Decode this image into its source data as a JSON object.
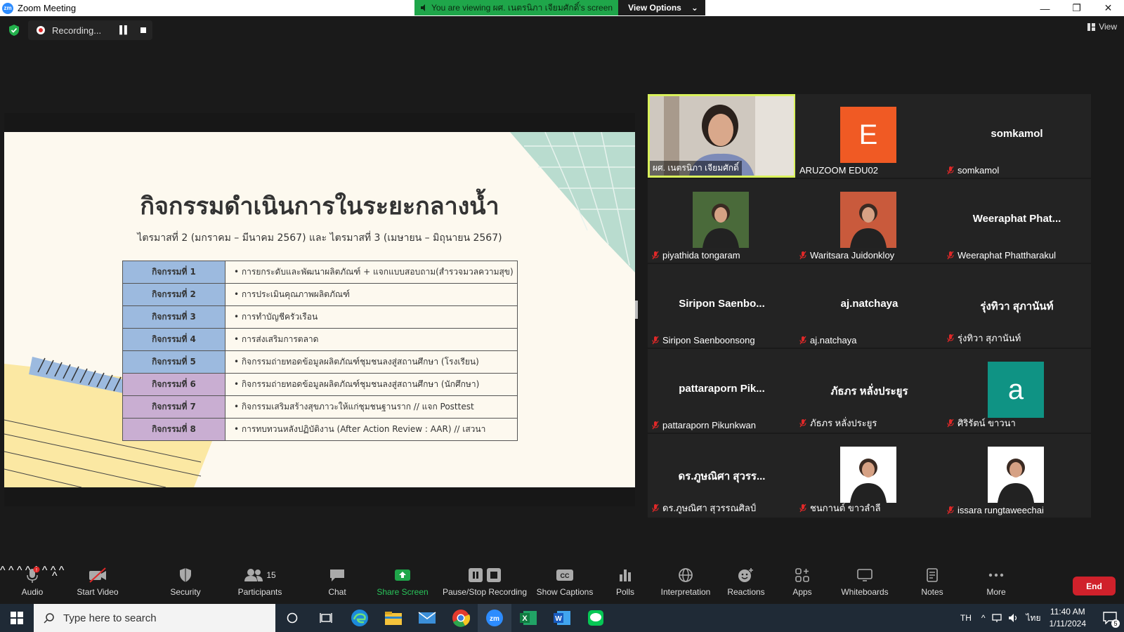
{
  "window": {
    "title": "Zoom Meeting",
    "sharing_banner": "You are viewing ผศ. เนตรนิภา เจียมศักดิ์'s screen",
    "view_options": "View Options"
  },
  "topbar": {
    "recording": "Recording...",
    "view": "View"
  },
  "slide": {
    "title": "กิจกรรมดำเนินการในระยะกลางน้ำ",
    "subtitle": "ไตรมาสที่ 2 (มกราคม – มีนาคม 2567) และ ไตรมาสที่ 3 (เมษายน – มิถุนายน 2567)",
    "activities": [
      {
        "key": "กิจกรรมที่ 1",
        "desc": "การยกระดับและพัฒนาผลิตภัณฑ์ + แจกแบบสอบถาม(สำรวจมวลความสุข)",
        "color": "#9cbadf"
      },
      {
        "key": "กิจกรรมที่ 2",
        "desc": "การประเมินคุณภาพผลิตภัณฑ์",
        "color": "#9cbadf"
      },
      {
        "key": "กิจกรรมที่ 3",
        "desc": "การทำบัญชีครัวเรือน",
        "color": "#9cbadf"
      },
      {
        "key": "กิจกรรมที่ 4",
        "desc": "การส่งเสริมการตลาด",
        "color": "#9cbadf"
      },
      {
        "key": "กิจกรรมที่ 5",
        "desc": "กิจกรรมถ่ายทอดข้อมูลผลิตภัณฑ์ชุมชนลงสู่สถานศึกษา (โรงเรียน)",
        "color": "#9cbadf"
      },
      {
        "key": "กิจกรรมที่ 6",
        "desc": "กิจกรรมถ่ายทอดข้อมูลผลิตภัณฑ์ชุมชนลงสู่สถานศึกษา (นักศึกษา)",
        "color": "#c9aed2"
      },
      {
        "key": "กิจกรรมที่ 7",
        "desc": "กิจกรรมเสริมสร้างสุขภาวะให้แก่ชุมชนฐานราก // แจก Posttest",
        "color": "#c9aed2"
      },
      {
        "key": "กิจกรรมที่ 8",
        "desc": "การทบทวนหลังปฏิบัติงาน (After Action Review : AAR) // เสวนา",
        "color": "#c9aed2"
      }
    ]
  },
  "participants": [
    {
      "display": "",
      "label": "ผศ. เนตรนิภา เจียมศักดิ์",
      "kind": "video"
    },
    {
      "display": "E",
      "label": "ARUZOOM EDU02",
      "kind": "avatar",
      "color": "#f05a24"
    },
    {
      "display": "somkamol",
      "label": "somkamol",
      "kind": "name"
    },
    {
      "display": "",
      "label": "piyathida tongaram",
      "kind": "photo",
      "color": "#4a6a3a"
    },
    {
      "display": "",
      "label": "Waritsara Juidonkloy",
      "kind": "photo",
      "color": "#c95a3c"
    },
    {
      "display": "Weeraphat  Phat...",
      "label": "Weeraphat Phattharakul",
      "kind": "name"
    },
    {
      "display": "Siripon  Saenbo...",
      "label": "Siripon Saenboonsong",
      "kind": "name"
    },
    {
      "display": "aj.natchaya",
      "label": "aj.natchaya",
      "kind": "name"
    },
    {
      "display": "รุ่งทิวา สุภานันท์",
      "label": "รุ่งทิวา สุภานันท์",
      "kind": "name"
    },
    {
      "display": "pattaraporn  Pik...",
      "label": "pattaraporn Pikunkwan",
      "kind": "name"
    },
    {
      "display": "ภัธภร หลั่งประยูร",
      "label": "ภัธภร หลั่งประยูร",
      "kind": "name"
    },
    {
      "display": "a",
      "label": "ศิริรัตน์ ขาวนา",
      "kind": "avatar",
      "color": "#0f9384"
    },
    {
      "display": "ดร.ภูษณิศา สุวรร...",
      "label": "ดร.ภูษณิศา สุวรรณศิลป์",
      "kind": "name"
    },
    {
      "display": "",
      "label": "ชนกานต์ ขาวลำลี",
      "kind": "photo",
      "color": "#ffffff"
    },
    {
      "display": "",
      "label": "issara rungtaweechai",
      "kind": "photo",
      "color": "#ffffff"
    }
  ],
  "toolbar": {
    "audio": "Audio",
    "start_video": "Start Video",
    "security": "Security",
    "participants": "Participants",
    "participants_count": "15",
    "chat": "Chat",
    "share_screen": "Share Screen",
    "pause_recording": "Pause/Stop Recording",
    "captions": "Show Captions",
    "polls": "Polls",
    "interpretation": "Interpretation",
    "reactions": "Reactions",
    "apps": "Apps",
    "whiteboards": "Whiteboards",
    "notes": "Notes",
    "more": "More",
    "end": "End"
  },
  "taskbar": {
    "search_placeholder": "Type here to search",
    "lang": "TH",
    "ime": "ไทย",
    "time": "11:40 AM",
    "date": "1/11/2024",
    "notifications": "5"
  },
  "colors": {
    "accent_green": "#1fa64a",
    "end_red": "#d0212b",
    "active_speaker": "#d9f15b",
    "zoom_blue": "#2D8CFF"
  }
}
